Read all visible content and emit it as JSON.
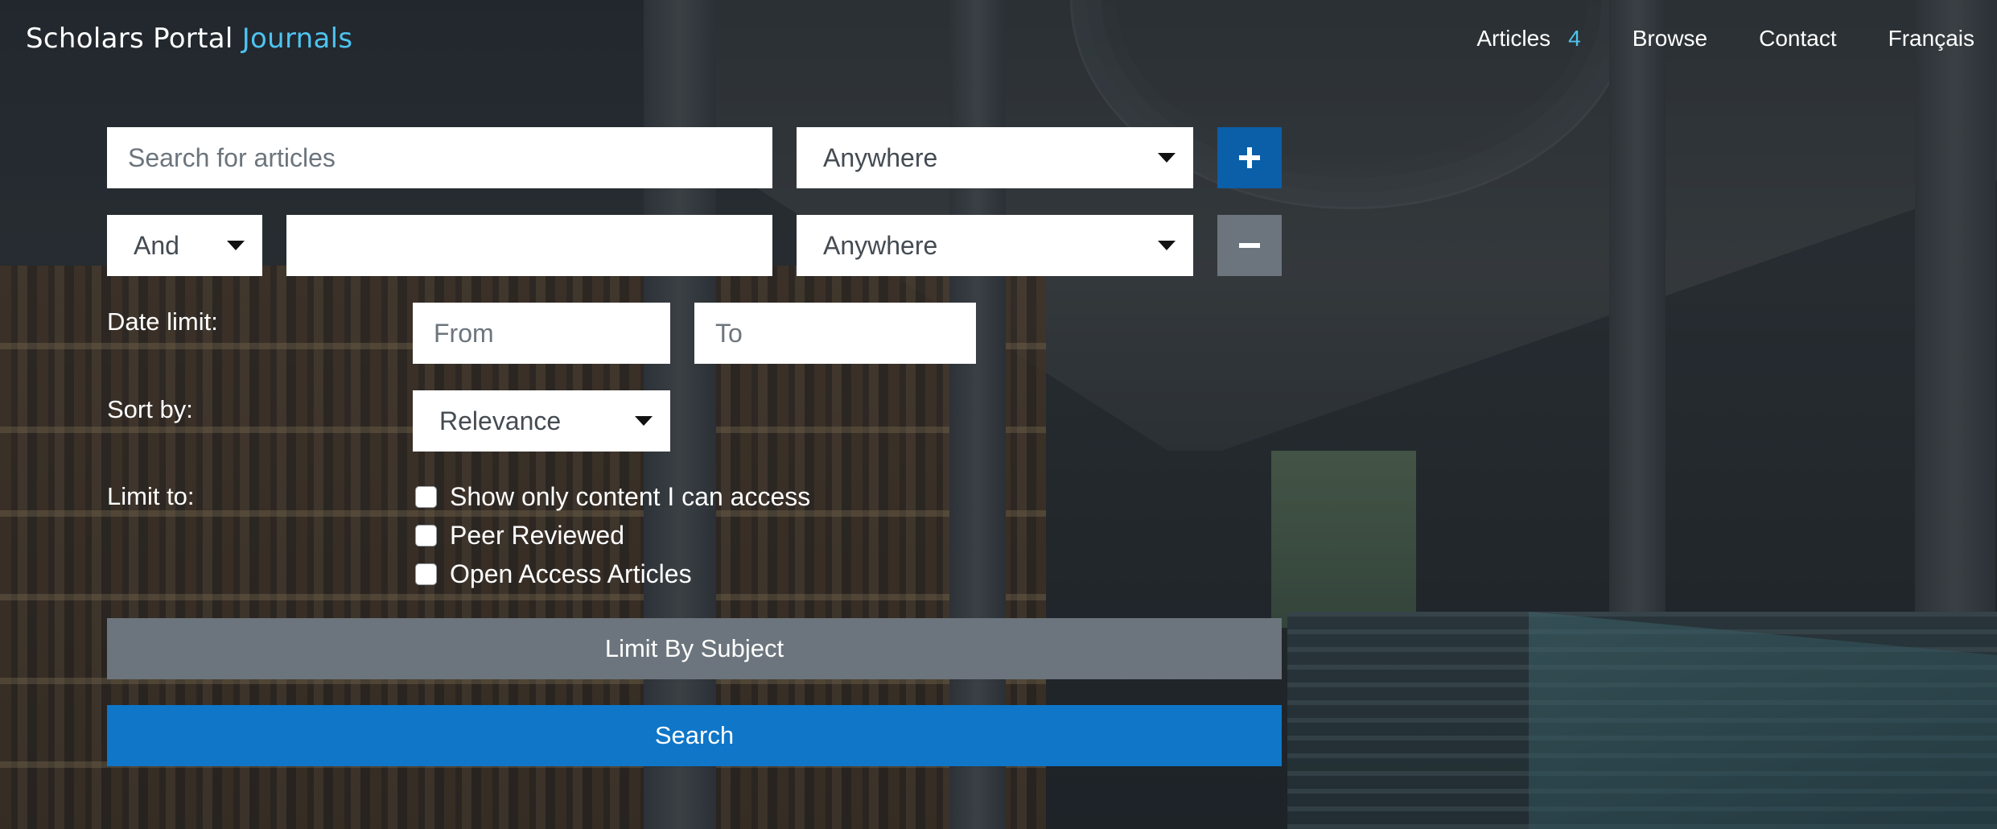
{
  "header": {
    "brand": {
      "name": "Scholars Portal",
      "accent": "Journals"
    },
    "nav": {
      "articles_label": "Articles",
      "articles_count": "4",
      "browse": "Browse",
      "contact": "Contact",
      "language": "Français"
    }
  },
  "search": {
    "row1": {
      "placeholder": "Search for articles",
      "field_select": "Anywhere"
    },
    "row2": {
      "operator": "And",
      "value": "",
      "field_select": "Anywhere"
    }
  },
  "date_limit": {
    "label": "Date limit:",
    "from_placeholder": "From",
    "to_placeholder": "To"
  },
  "sort": {
    "label": "Sort by:",
    "selected": "Relevance"
  },
  "limit_to": {
    "label": "Limit to:",
    "options": [
      {
        "label": "Show only content I can access",
        "checked": false
      },
      {
        "label": "Peer Reviewed",
        "checked": false
      },
      {
        "label": "Open Access Articles",
        "checked": false
      }
    ]
  },
  "buttons": {
    "limit_by_subject": "Limit By Subject",
    "search": "Search"
  },
  "colors": {
    "accent": "#4ec3f0",
    "primary_button": "#0f76c8",
    "plus_button": "#0b5fa8",
    "secondary_button": "#6c757d"
  },
  "icons": {
    "add_row": "plus-icon",
    "remove_row": "minus-icon",
    "dropdown": "caret-down-icon"
  }
}
